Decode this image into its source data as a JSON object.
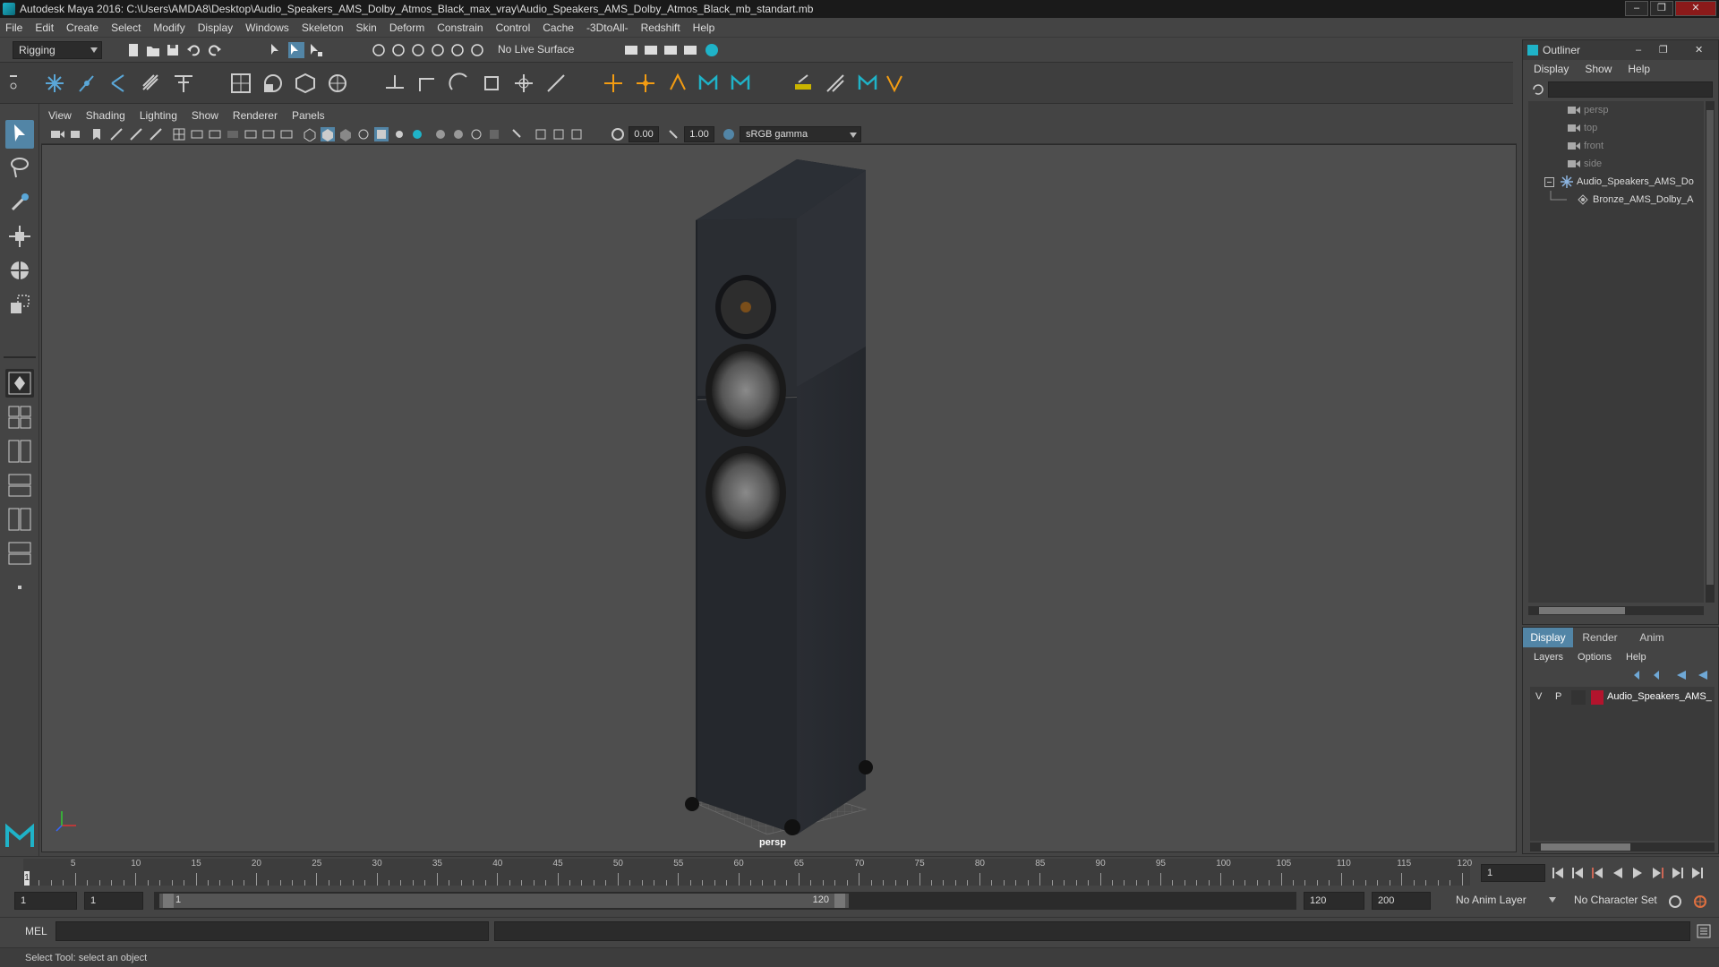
{
  "title": "Autodesk Maya 2016: C:\\Users\\AMDA8\\Desktop\\Audio_Speakers_AMS_Dolby_Atmos_Black_max_vray\\Audio_Speakers_AMS_Dolby_Atmos_Black_mb_standart.mb",
  "window_buttons": {
    "minimize": "–",
    "maximize": "❐",
    "close": "✕"
  },
  "menubar": [
    "File",
    "Edit",
    "Create",
    "Select",
    "Modify",
    "Display",
    "Windows",
    "Skeleton",
    "Skin",
    "Deform",
    "Constrain",
    "Control",
    "Cache",
    "-3DtoAll-",
    "Redshift",
    "Help"
  ],
  "status_line": {
    "menu_set": "Rigging",
    "live_surface": "No Live Surface"
  },
  "panel_menu": [
    "View",
    "Shading",
    "Lighting",
    "Show",
    "Renderer",
    "Panels"
  ],
  "panel_toolbar": {
    "exposure": "0.00",
    "gamma": "1.00",
    "color_space": "sRGB gamma"
  },
  "viewport": {
    "camera_label": "persp"
  },
  "outliner": {
    "title": "Outliner",
    "menu": [
      "Display",
      "Show",
      "Help"
    ],
    "items": [
      {
        "label": "persp",
        "type": "camera",
        "depth": 1
      },
      {
        "label": "top",
        "type": "camera",
        "depth": 1
      },
      {
        "label": "front",
        "type": "camera",
        "depth": 1
      },
      {
        "label": "side",
        "type": "camera",
        "depth": 1
      },
      {
        "label": "Audio_Speakers_AMS_Do",
        "type": "group",
        "depth": 0,
        "expanded": true
      },
      {
        "label": "Bronze_AMS_Dolby_A",
        "type": "mesh",
        "depth": 2
      }
    ]
  },
  "channel_box": {
    "tabs": [
      "Display",
      "Render",
      "Anim"
    ],
    "active_tab": "Display",
    "layer_menu": [
      "Layers",
      "Options",
      "Help"
    ],
    "layers": [
      {
        "visible": "V",
        "playback": "P",
        "color": "#b3142d",
        "name": "Audio_Speakers_AMS_"
      }
    ]
  },
  "timeline": {
    "ticks": [
      "5",
      "10",
      "15",
      "20",
      "25",
      "30",
      "35",
      "40",
      "45",
      "50",
      "55",
      "60",
      "65",
      "70",
      "75",
      "80",
      "85",
      "90",
      "95",
      "100",
      "105",
      "110",
      "115",
      "120"
    ],
    "current_frame_marker": "1",
    "current_frame": "1"
  },
  "range": {
    "start": "1",
    "playback_start": "1",
    "slider_start": "1",
    "slider_end": "120",
    "playback_end": "120",
    "end": "200",
    "anim_layer": "No Anim Layer",
    "character_set": "No Character Set"
  },
  "command_line": {
    "label": "MEL"
  },
  "help_line": "Select Tool: select an object",
  "colors": {
    "accent": "#1fb3c8",
    "active_tab": "#5285a6",
    "layer_color": "#b3142d"
  }
}
